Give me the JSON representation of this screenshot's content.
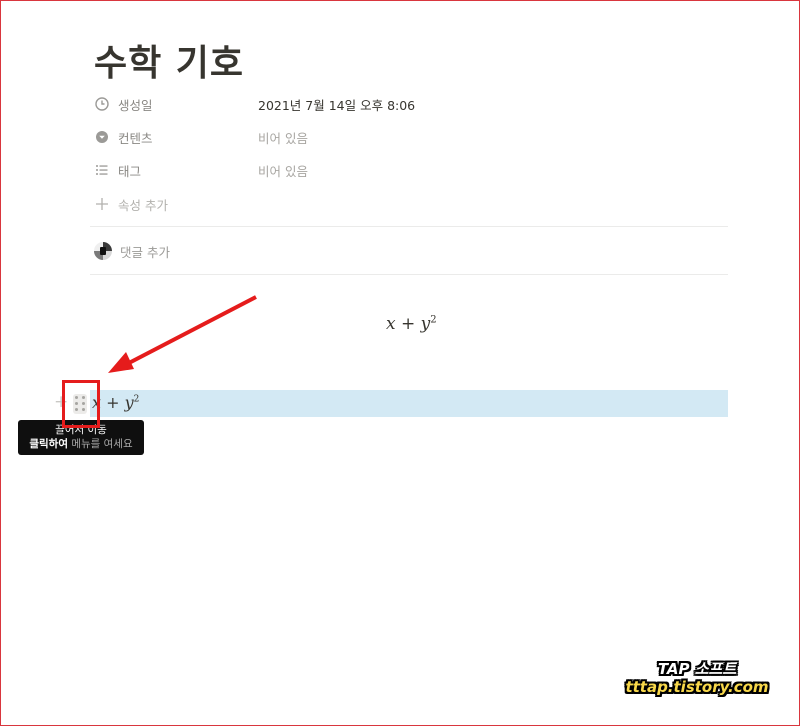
{
  "page": {
    "title": "수학 기호"
  },
  "properties": [
    {
      "icon": "clock-icon",
      "name": "생성일",
      "value": "2021년 7월 14일 오후 8:06",
      "empty": false
    },
    {
      "icon": "dropdown-circle-icon",
      "name": "컨텐츠",
      "value": "비어 있음",
      "empty": true
    },
    {
      "icon": "list-icon",
      "name": "태그",
      "value": "비어 있음",
      "empty": true
    }
  ],
  "add_property_label": "속성 추가",
  "add_comment_label": "댓글 추가",
  "math": {
    "display_equation": "x + y²",
    "inline": {
      "x": "x",
      "plus": "+",
      "y": "y",
      "exp": "2"
    }
  },
  "block": {
    "plus_symbol": "+"
  },
  "tooltip": {
    "line1": "끌어서 이동",
    "line2_bold": "클릭하여",
    "line2_rest": "메뉴를 여세요"
  },
  "watermark": {
    "line1": "TAP 소프트",
    "line2": "tttap.tistory.com"
  },
  "colors": {
    "annotation_red": "#e51c1c",
    "selection_blue": "#d3e9f4"
  }
}
